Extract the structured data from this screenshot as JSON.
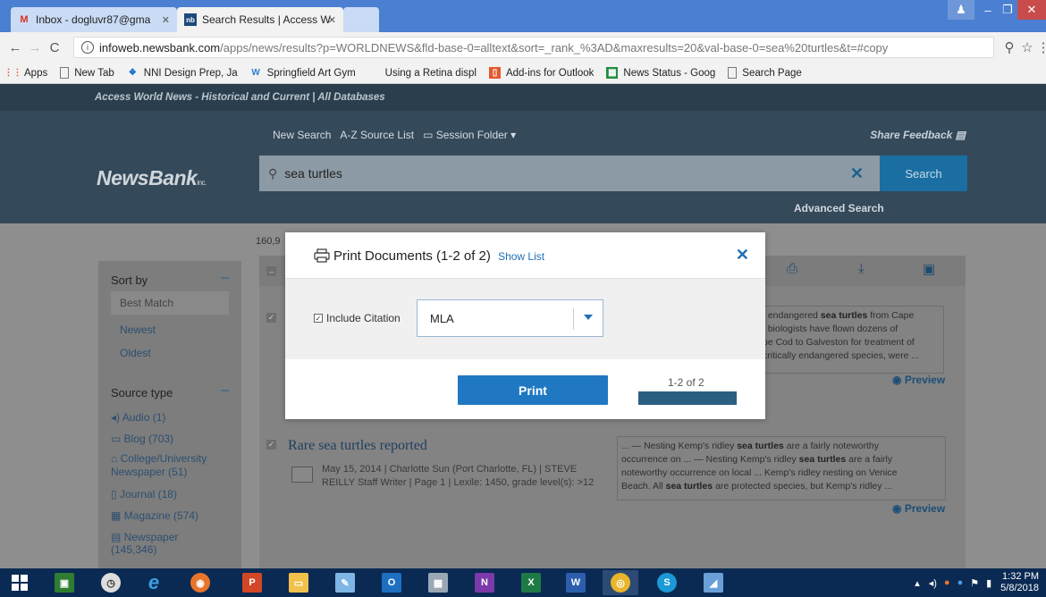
{
  "browser": {
    "tabs": [
      {
        "title": "Inbox - dogluvr87@gma",
        "icon": "gmail-icon"
      },
      {
        "title": "Search Results | Access W",
        "icon": "newsbank-icon"
      }
    ],
    "url_host": "infoweb.newsbank.com",
    "url_path": "/apps/news/results?p=WORLDNEWS&fld-base-0=alltext&sort=_rank_%3AD&maxresults=20&val-base-0=sea%20turtles&t=#copy",
    "bookmarks": [
      "Apps",
      "New Tab",
      "NNI Design Prep, Ja",
      "Springfield Art Gym",
      "Using a Retina displ",
      "Add-ins for Outlook",
      "News Status - Goog",
      "Search Page"
    ]
  },
  "site": {
    "strip": "Access World News - Historical and Current  |  All Databases",
    "nav": [
      "New Search",
      "A-Z Source List",
      "Session Folder"
    ],
    "share_feedback": "Share Feedback",
    "logo": "NewsBank",
    "logo_suffix": "inc.",
    "search_value": "sea turtles",
    "search_button": "Search",
    "advanced_search": "Advanced Search",
    "result_count": "160,9"
  },
  "sidebar": {
    "sort_heading": "Sort by",
    "sort_options": [
      "Best Match",
      "Newest",
      "Oldest"
    ],
    "source_heading": "Source type",
    "source_items": [
      {
        "label": "Audio (1)",
        "icon": "audio-icon"
      },
      {
        "label": "Blog (703)",
        "icon": "blog-icon"
      },
      {
        "label": "College/University Newspaper (51)",
        "icon": "college-icon"
      },
      {
        "label": "Journal (18)",
        "icon": "journal-icon"
      },
      {
        "label": "Magazine (574)",
        "icon": "magazine-icon"
      },
      {
        "label": "Newspaper (145,346)",
        "icon": "newspaper-icon"
      }
    ]
  },
  "results": {
    "first_snippet": {
      "lines": [
        [
          "f endangered ",
          "sea turtles",
          " from Cape"
        ],
        [
          ". biologists have flown dozens of",
          "",
          ""
        ],
        [
          "pe Cod to Galveston for treatment of",
          "",
          ""
        ],
        [
          " critically endangered species, were ...",
          "",
          ""
        ]
      ]
    },
    "preview_label": "Preview",
    "second": {
      "title": "Rare sea turtles reported",
      "meta": "May 15, 2014  |  Charlotte Sun (Port Charlotte, FL)  |  STEVE REILLY Staff Writer  |  Page 1  |  Lexile: 1450, grade level(s): >12",
      "snippet": [
        [
          "... — Nesting Kemp's ridley ",
          "sea turtles",
          " are a fairly noteworthy"
        ],
        [
          "occurrence on ... — Nesting Kemp's ridley ",
          "sea turtles",
          " are a fairly"
        ],
        [
          "noteworthy occurrence on local ... Kemp's ridley nesting on Venice",
          "",
          ""
        ],
        [
          "Beach. All ",
          "sea turtles",
          " are protected species, but Kemp's ridley ..."
        ]
      ]
    }
  },
  "modal": {
    "title": "Print Documents (1-2 of 2)",
    "show_list": "Show List",
    "include_citation": "Include Citation",
    "citation_checked": true,
    "citation_style": "MLA",
    "print_button": "Print",
    "progress_label": "1-2 of 2",
    "progress_fraction": 1.0
  },
  "taskbar": {
    "time": "1:32 PM",
    "date": "5/8/2018",
    "apps": [
      "start-icon",
      "store-icon",
      "clock-icon",
      "ie-icon",
      "firefox-icon",
      "powerpoint-icon",
      "file-explorer-icon",
      "paint-icon",
      "outlook-icon",
      "calculator-icon",
      "onenote-icon",
      "excel-icon",
      "word-icon",
      "chrome-icon",
      "skype-icon",
      "app-icon"
    ]
  }
}
